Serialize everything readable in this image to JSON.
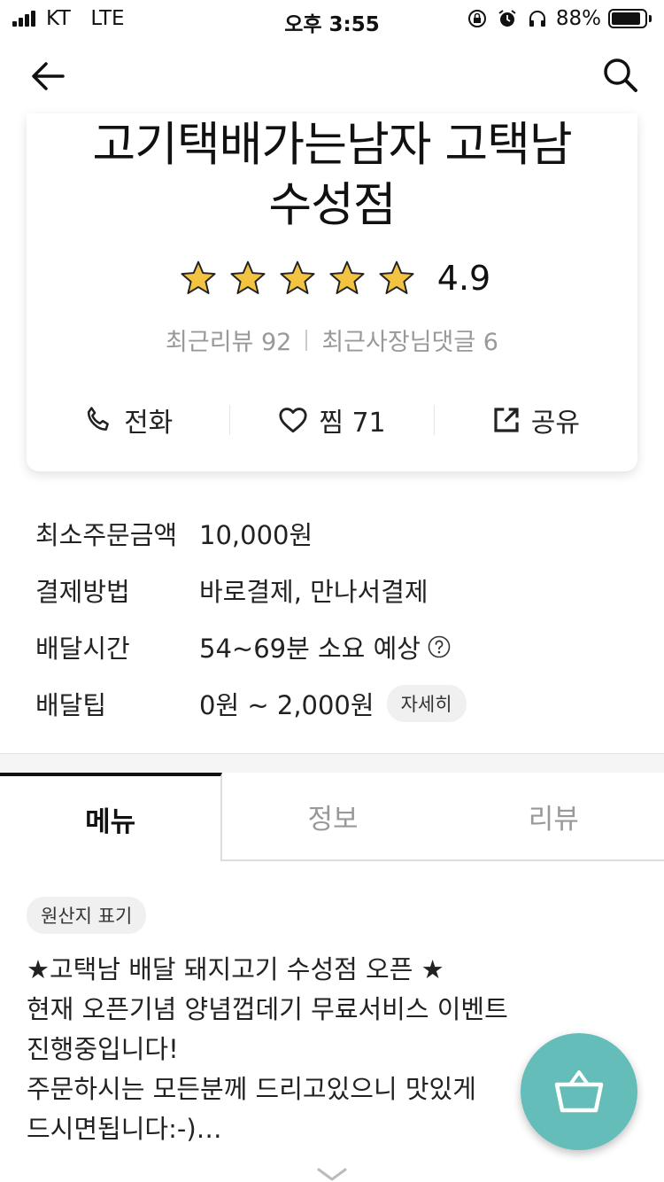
{
  "status_bar": {
    "carrier": "KT",
    "network": "LTE",
    "time": "오후 3:55",
    "battery_percent": "88%",
    "battery_level": 0.88
  },
  "header": {
    "back_icon": "arrow-left-icon",
    "search_icon": "search-icon"
  },
  "store": {
    "name_line1": "고기택배가는남자 고택남",
    "name_line2": "수성점",
    "rating": "4.9",
    "stars_filled": 5,
    "recent_reviews": "최근리뷰 92",
    "recent_owner_replies": "최근사장님댓글 6",
    "actions": {
      "call": "전화",
      "like": "찜 71",
      "share": "공유"
    },
    "star_color": "#f3c441"
  },
  "info": {
    "min_order_label": "최소주문금액",
    "min_order_value": "10,000원",
    "payment_label": "결제방법",
    "payment_value": "바로결제, 만나서결제",
    "delivery_time_label": "배달시간",
    "delivery_time_value": "54~69분 소요 예상",
    "delivery_tip_label": "배달팁",
    "delivery_tip_value": "0원 ~ 2,000원",
    "detail_button": "자세히"
  },
  "tabs": [
    {
      "label": "메뉴",
      "active": true
    },
    {
      "label": "정보",
      "active": false
    },
    {
      "label": "리뷰",
      "active": false
    }
  ],
  "content": {
    "origin_chip": "원산지 표기",
    "notice": "★고택남 배달 돼지고기 수성점 오픈 ★\n 현재 오픈기념 양념껍데기 무료서비스 이벤트\n진행중입니다!\n주문하시는 모든분께 드리고있으니 맛있게\n드시면됩니다:-)…"
  },
  "cart_button": {
    "icon": "basket-icon",
    "color": "#64bdb9"
  }
}
